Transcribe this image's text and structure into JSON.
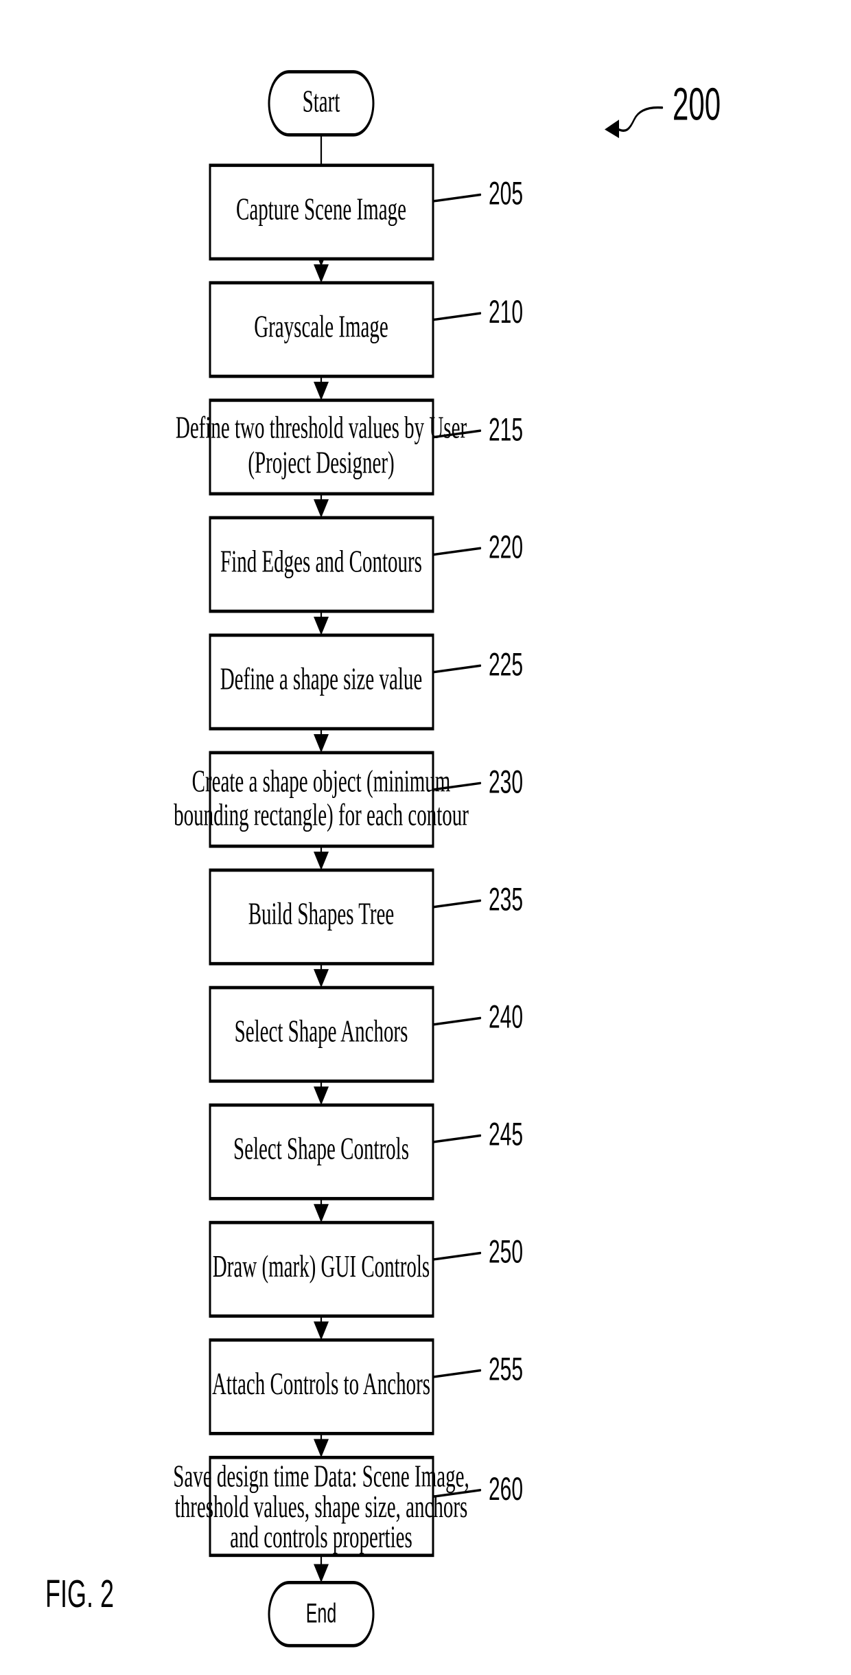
{
  "figure": {
    "caption": "FIG. 2",
    "callout_number": "200"
  },
  "terminals": {
    "start": {
      "label": "Start",
      "ref": ""
    },
    "end": {
      "label": "End",
      "ref": ""
    }
  },
  "steps": [
    {
      "ref": "205",
      "lines": [
        "Capture Scene Image"
      ]
    },
    {
      "ref": "210",
      "lines": [
        "Grayscale Image"
      ]
    },
    {
      "ref": "215",
      "lines": [
        "Define two threshold values by User",
        "(Project Designer)"
      ]
    },
    {
      "ref": "220",
      "lines": [
        "Find Edges and Contours"
      ]
    },
    {
      "ref": "225",
      "lines": [
        "Define a shape size value"
      ]
    },
    {
      "ref": "230",
      "lines": [
        "Create a shape object (minimum",
        "bounding rectangle) for each contour"
      ]
    },
    {
      "ref": "235",
      "lines": [
        "Build Shapes Tree"
      ]
    },
    {
      "ref": "240",
      "lines": [
        "Select Shape Anchors"
      ]
    },
    {
      "ref": "245",
      "lines": [
        "Select Shape Controls"
      ]
    },
    {
      "ref": "250",
      "lines": [
        "Draw (mark) GUI Controls"
      ]
    },
    {
      "ref": "255",
      "lines": [
        "Attach Controls to Anchors"
      ]
    },
    {
      "ref": "260",
      "lines": [
        "Save design time Data: Scene Image,",
        "threshold values, shape size, anchors",
        "and controls properties"
      ]
    }
  ],
  "colors": {
    "stroke": "#000000",
    "fill": "#ffffff",
    "background": "#ffffff"
  }
}
